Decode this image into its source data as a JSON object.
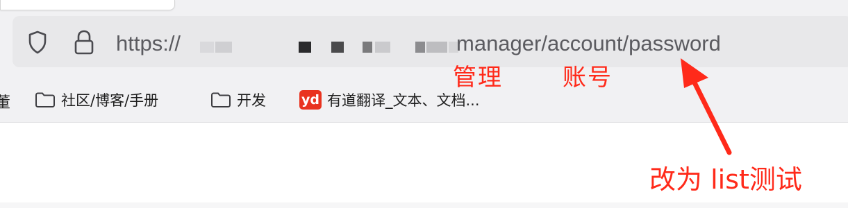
{
  "browser": {
    "url_bar": {
      "prefix": "https://",
      "visible_path": "manager/account/password",
      "redacted": true
    },
    "icons": {
      "shield": "shield-icon",
      "lock": "lock-icon"
    }
  },
  "annotations": {
    "manage_label": "管理",
    "account_label": "账号",
    "note": "改为 list测试",
    "color": "#ff2a1a"
  },
  "bookmarks": {
    "cut_item": "董",
    "items": [
      {
        "icon": "folder-icon",
        "label": "社区/博客/手册"
      },
      {
        "icon": "folder-icon",
        "label": "开发"
      },
      {
        "icon": "youdao-icon",
        "icon_text": "yd",
        "label": "有道翻译_文本、文档..."
      }
    ]
  }
}
